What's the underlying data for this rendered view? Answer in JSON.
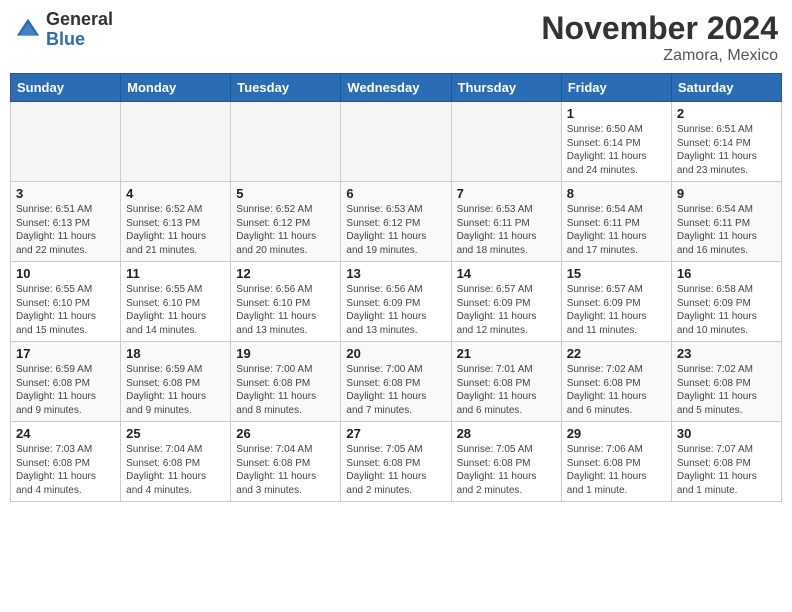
{
  "header": {
    "logo_line1": "General",
    "logo_line2": "Blue",
    "month": "November 2024",
    "location": "Zamora, Mexico"
  },
  "weekdays": [
    "Sunday",
    "Monday",
    "Tuesday",
    "Wednesday",
    "Thursday",
    "Friday",
    "Saturday"
  ],
  "weeks": [
    [
      {
        "day": "",
        "info": "",
        "empty": true
      },
      {
        "day": "",
        "info": "",
        "empty": true
      },
      {
        "day": "",
        "info": "",
        "empty": true
      },
      {
        "day": "",
        "info": "",
        "empty": true
      },
      {
        "day": "",
        "info": "",
        "empty": true
      },
      {
        "day": "1",
        "info": "Sunrise: 6:50 AM\nSunset: 6:14 PM\nDaylight: 11 hours\nand 24 minutes.",
        "empty": false
      },
      {
        "day": "2",
        "info": "Sunrise: 6:51 AM\nSunset: 6:14 PM\nDaylight: 11 hours\nand 23 minutes.",
        "empty": false
      }
    ],
    [
      {
        "day": "3",
        "info": "Sunrise: 6:51 AM\nSunset: 6:13 PM\nDaylight: 11 hours\nand 22 minutes.",
        "empty": false
      },
      {
        "day": "4",
        "info": "Sunrise: 6:52 AM\nSunset: 6:13 PM\nDaylight: 11 hours\nand 21 minutes.",
        "empty": false
      },
      {
        "day": "5",
        "info": "Sunrise: 6:52 AM\nSunset: 6:12 PM\nDaylight: 11 hours\nand 20 minutes.",
        "empty": false
      },
      {
        "day": "6",
        "info": "Sunrise: 6:53 AM\nSunset: 6:12 PM\nDaylight: 11 hours\nand 19 minutes.",
        "empty": false
      },
      {
        "day": "7",
        "info": "Sunrise: 6:53 AM\nSunset: 6:11 PM\nDaylight: 11 hours\nand 18 minutes.",
        "empty": false
      },
      {
        "day": "8",
        "info": "Sunrise: 6:54 AM\nSunset: 6:11 PM\nDaylight: 11 hours\nand 17 minutes.",
        "empty": false
      },
      {
        "day": "9",
        "info": "Sunrise: 6:54 AM\nSunset: 6:11 PM\nDaylight: 11 hours\nand 16 minutes.",
        "empty": false
      }
    ],
    [
      {
        "day": "10",
        "info": "Sunrise: 6:55 AM\nSunset: 6:10 PM\nDaylight: 11 hours\nand 15 minutes.",
        "empty": false
      },
      {
        "day": "11",
        "info": "Sunrise: 6:55 AM\nSunset: 6:10 PM\nDaylight: 11 hours\nand 14 minutes.",
        "empty": false
      },
      {
        "day": "12",
        "info": "Sunrise: 6:56 AM\nSunset: 6:10 PM\nDaylight: 11 hours\nand 13 minutes.",
        "empty": false
      },
      {
        "day": "13",
        "info": "Sunrise: 6:56 AM\nSunset: 6:09 PM\nDaylight: 11 hours\nand 13 minutes.",
        "empty": false
      },
      {
        "day": "14",
        "info": "Sunrise: 6:57 AM\nSunset: 6:09 PM\nDaylight: 11 hours\nand 12 minutes.",
        "empty": false
      },
      {
        "day": "15",
        "info": "Sunrise: 6:57 AM\nSunset: 6:09 PM\nDaylight: 11 hours\nand 11 minutes.",
        "empty": false
      },
      {
        "day": "16",
        "info": "Sunrise: 6:58 AM\nSunset: 6:09 PM\nDaylight: 11 hours\nand 10 minutes.",
        "empty": false
      }
    ],
    [
      {
        "day": "17",
        "info": "Sunrise: 6:59 AM\nSunset: 6:08 PM\nDaylight: 11 hours\nand 9 minutes.",
        "empty": false
      },
      {
        "day": "18",
        "info": "Sunrise: 6:59 AM\nSunset: 6:08 PM\nDaylight: 11 hours\nand 9 minutes.",
        "empty": false
      },
      {
        "day": "19",
        "info": "Sunrise: 7:00 AM\nSunset: 6:08 PM\nDaylight: 11 hours\nand 8 minutes.",
        "empty": false
      },
      {
        "day": "20",
        "info": "Sunrise: 7:00 AM\nSunset: 6:08 PM\nDaylight: 11 hours\nand 7 minutes.",
        "empty": false
      },
      {
        "day": "21",
        "info": "Sunrise: 7:01 AM\nSunset: 6:08 PM\nDaylight: 11 hours\nand 6 minutes.",
        "empty": false
      },
      {
        "day": "22",
        "info": "Sunrise: 7:02 AM\nSunset: 6:08 PM\nDaylight: 11 hours\nand 6 minutes.",
        "empty": false
      },
      {
        "day": "23",
        "info": "Sunrise: 7:02 AM\nSunset: 6:08 PM\nDaylight: 11 hours\nand 5 minutes.",
        "empty": false
      }
    ],
    [
      {
        "day": "24",
        "info": "Sunrise: 7:03 AM\nSunset: 6:08 PM\nDaylight: 11 hours\nand 4 minutes.",
        "empty": false
      },
      {
        "day": "25",
        "info": "Sunrise: 7:04 AM\nSunset: 6:08 PM\nDaylight: 11 hours\nand 4 minutes.",
        "empty": false
      },
      {
        "day": "26",
        "info": "Sunrise: 7:04 AM\nSunset: 6:08 PM\nDaylight: 11 hours\nand 3 minutes.",
        "empty": false
      },
      {
        "day": "27",
        "info": "Sunrise: 7:05 AM\nSunset: 6:08 PM\nDaylight: 11 hours\nand 2 minutes.",
        "empty": false
      },
      {
        "day": "28",
        "info": "Sunrise: 7:05 AM\nSunset: 6:08 PM\nDaylight: 11 hours\nand 2 minutes.",
        "empty": false
      },
      {
        "day": "29",
        "info": "Sunrise: 7:06 AM\nSunset: 6:08 PM\nDaylight: 11 hours\nand 1 minute.",
        "empty": false
      },
      {
        "day": "30",
        "info": "Sunrise: 7:07 AM\nSunset: 6:08 PM\nDaylight: 11 hours\nand 1 minute.",
        "empty": false
      }
    ]
  ]
}
